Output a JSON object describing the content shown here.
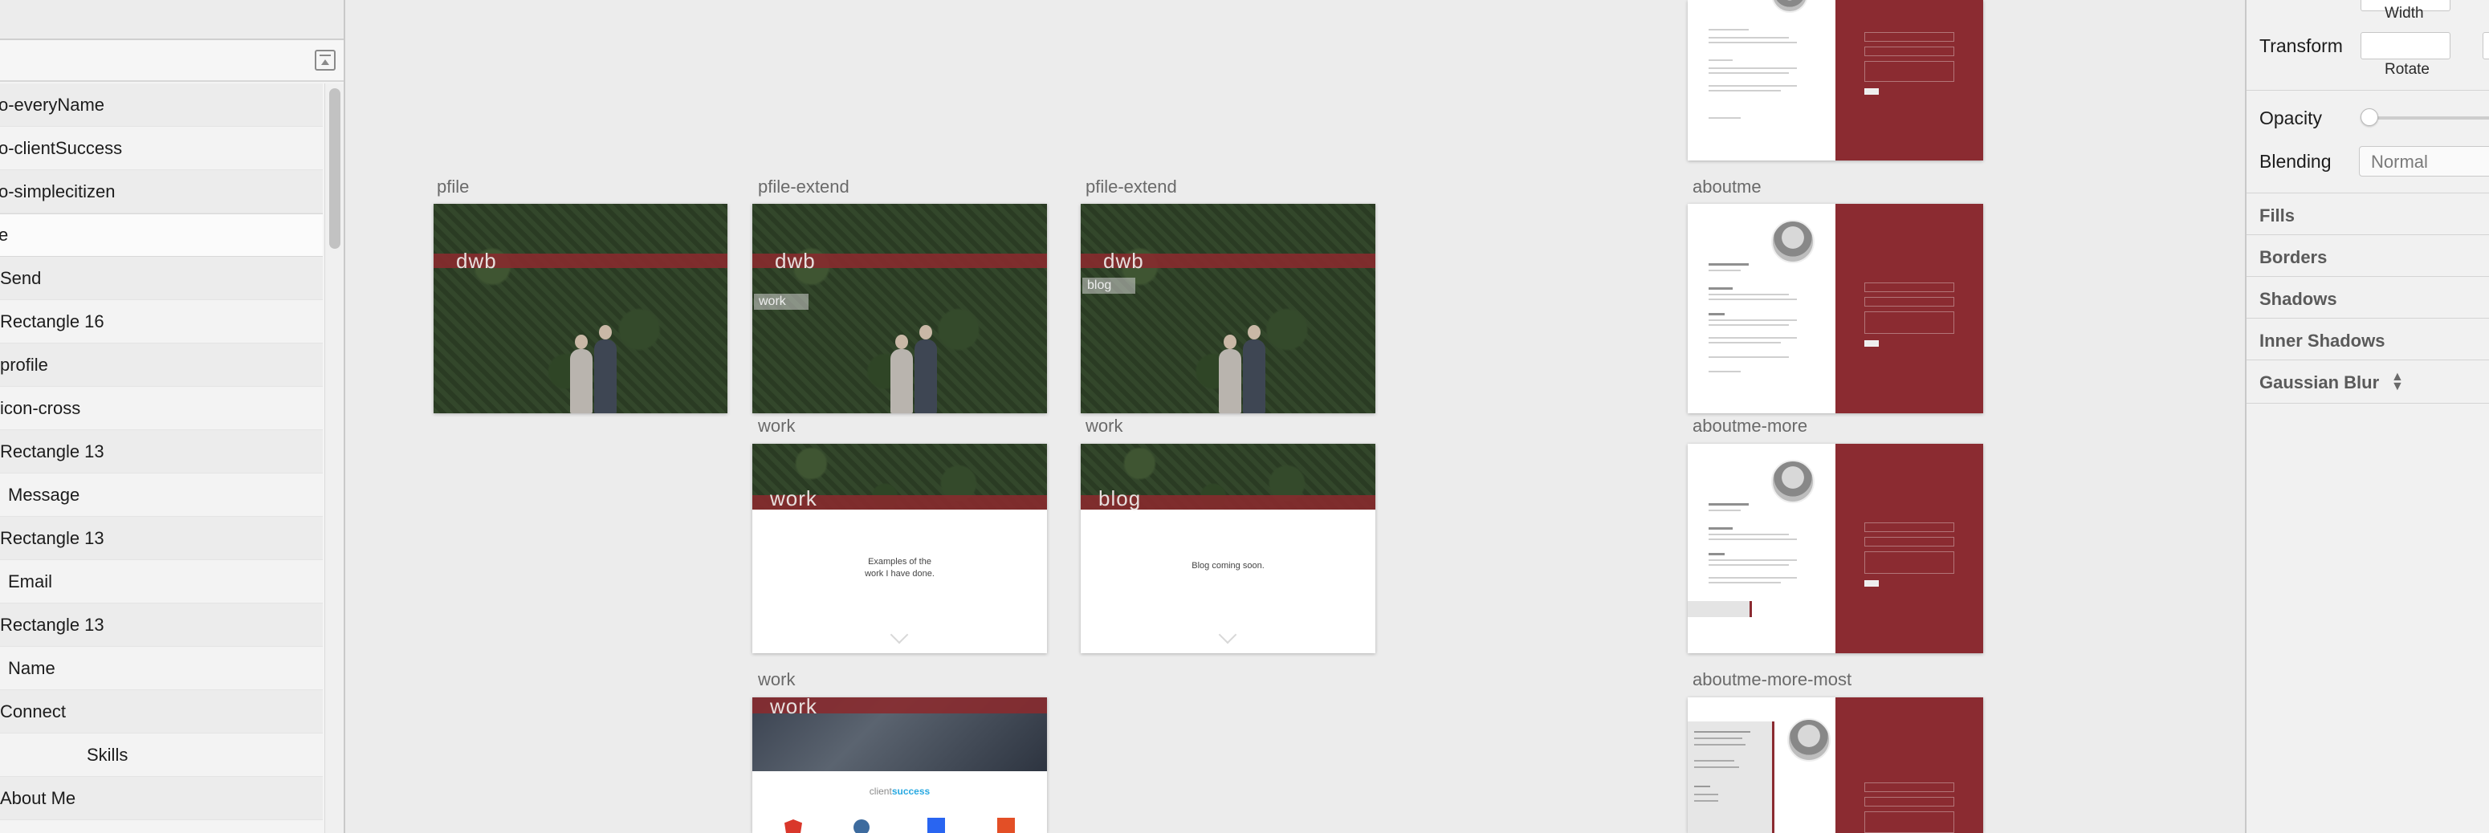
{
  "layers": {
    "items": [
      {
        "label": "o-everyName"
      },
      {
        "label": "o-clientSuccess"
      },
      {
        "label": "o-simplecitizen"
      },
      {
        "label": "e",
        "selected": true
      },
      {
        "label": "Send"
      },
      {
        "label": "Rectangle 16"
      },
      {
        "label": "profile"
      },
      {
        "label": "icon-cross"
      },
      {
        "label": "Rectangle 13"
      },
      {
        "label": "Message"
      },
      {
        "label": "Rectangle 13"
      },
      {
        "label": "Email"
      },
      {
        "label": "Rectangle 13"
      },
      {
        "label": "Name"
      },
      {
        "label": "Connect"
      },
      {
        "label": "Skills"
      },
      {
        "label": "About Me"
      }
    ]
  },
  "canvas": {
    "artboards": [
      {
        "label": "pfile",
        "hero_text": "dwb"
      },
      {
        "label": "pfile-extend",
        "hero_text": "dwb",
        "tag": "work"
      },
      {
        "label": "pfile-extend",
        "hero_text": "dwb",
        "tag": "blog"
      },
      {
        "label": "work",
        "header": "work",
        "caption_line1": "Examples of the",
        "caption_line2": "work I have done."
      },
      {
        "label": "work",
        "header": "blog",
        "caption": "Blog coming soon."
      },
      {
        "label": "work",
        "header": "work",
        "brand_a": "client",
        "brand_b": "success"
      },
      {
        "label": "aboutme"
      },
      {
        "label": "aboutme-more"
      },
      {
        "label": "aboutme-more-most"
      }
    ]
  },
  "inspector": {
    "width_label": "Width",
    "transform_label": "Transform",
    "rotate_label": "Rotate",
    "opacity_label": "Opacity",
    "opacity_value": 0,
    "blending_label": "Blending",
    "blending_value": "Normal",
    "sections": [
      "Fills",
      "Borders",
      "Shadows",
      "Inner Shadows",
      "Gaussian Blur"
    ]
  },
  "colors": {
    "accent_red": "#8b2b31",
    "foliage": "#2e4127",
    "canvas_bg": "#ececec",
    "client_blue": "#29a9e1"
  },
  "icons": [
    "collapse-icon",
    "updown-arrows-icon",
    "chevron-down-icon"
  ]
}
